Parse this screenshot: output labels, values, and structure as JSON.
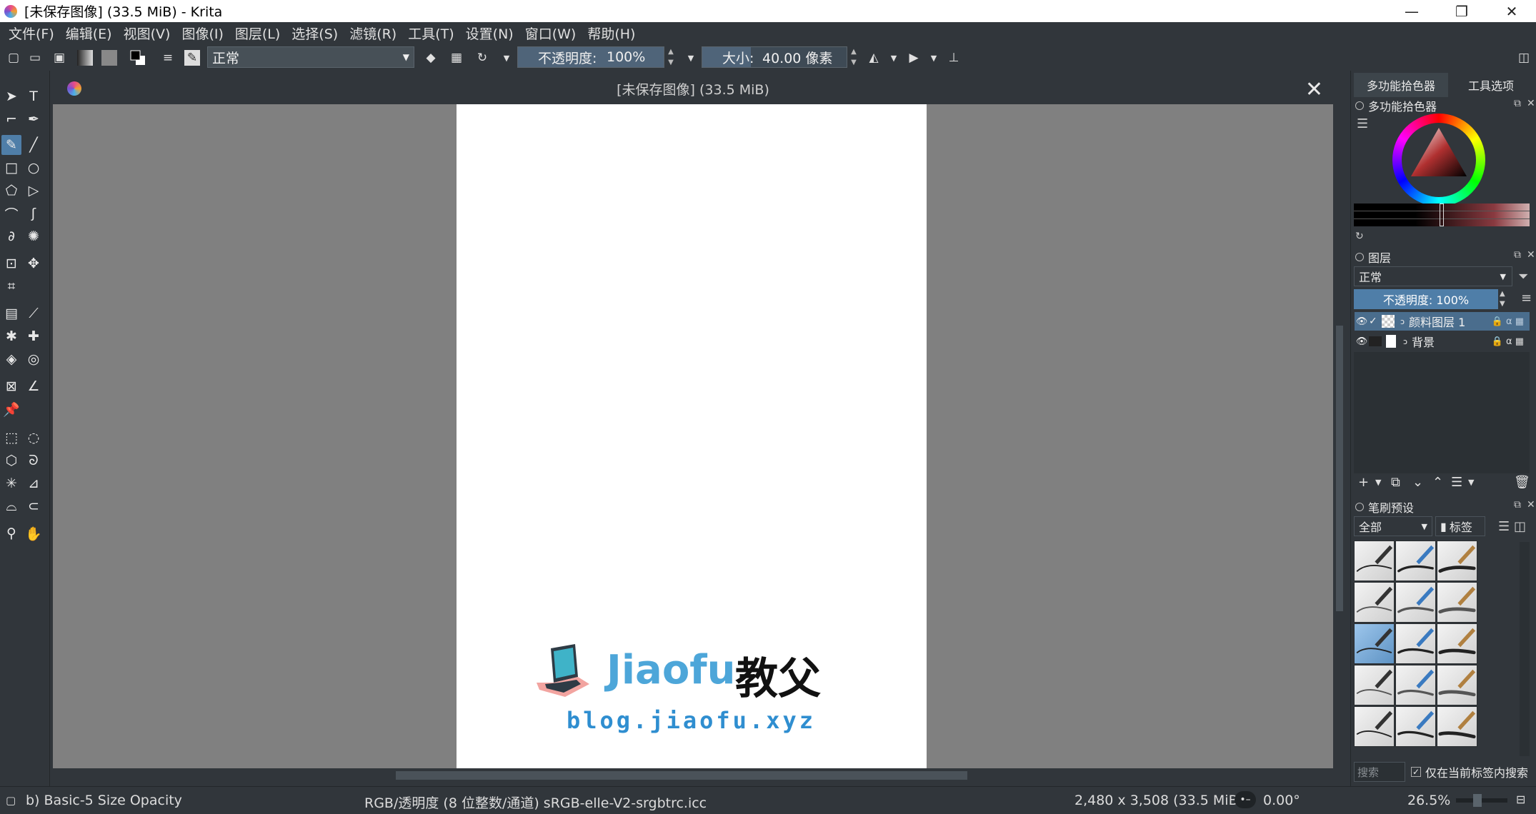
{
  "window": {
    "title": "[未保存图像]  (33.5 MiB)  - Krita",
    "controls": {
      "minimize": "—",
      "restore": "❐",
      "close": "✕"
    }
  },
  "menu": [
    "文件(F)",
    "编辑(E)",
    "视图(V)",
    "图像(I)",
    "图层(L)",
    "选择(S)",
    "滤镜(R)",
    "工具(T)",
    "设置(N)",
    "窗口(W)",
    "帮助(H)"
  ],
  "toolbar": {
    "blend_mode": "正常",
    "opacity_label": "不透明度:",
    "opacity_value": "100%",
    "size_label": "大小:",
    "size_value": "40.00 像素"
  },
  "document": {
    "title": "[未保存图像]  (33.5 MiB)",
    "watermark": {
      "brand_latin": "Jiaofu",
      "brand_cjk": "教父",
      "url": "blog.jiaofu.xyz"
    }
  },
  "dock": {
    "tabs": [
      "多功能拾色器",
      "工具选项"
    ],
    "color_panel_title": "多功能拾色器",
    "layers": {
      "title": "图层",
      "blend_mode": "正常",
      "opacity_text": "不透明度:  100%",
      "items": [
        {
          "name": "颜料图层 1",
          "active": true
        },
        {
          "name": "背景",
          "active": false
        }
      ]
    },
    "brushes": {
      "title": "笔刷预设",
      "filter_value": "全部",
      "tag_label": "标签",
      "search_placeholder": "搜索",
      "current_tag_only_label": "仅在当前标签内搜索"
    }
  },
  "status": {
    "brush_name": "b) Basic-5 Size Opacity",
    "color_info": "RGB/透明度 (8 位整数/通道)  sRGB-elle-V2-srgbtrc.icc",
    "image_size": "2,480 x 3,508 (33.5 MiB)",
    "rotation": "0.00°",
    "zoom": "26.5%"
  },
  "colors": {
    "accent": "#4f7ea8",
    "ui_background": "#31363b",
    "canvas_background": "#808080",
    "watermark_blue": "#4da6d9"
  }
}
